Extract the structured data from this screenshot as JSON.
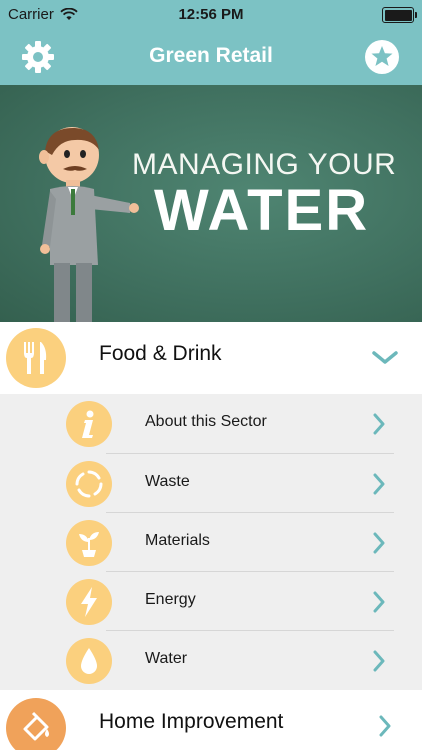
{
  "status_bar": {
    "carrier": "Carrier",
    "time": "12:56 PM"
  },
  "nav": {
    "title": "Green Retail",
    "left_icon": "gear-icon",
    "right_icon": "star-icon"
  },
  "banner": {
    "line1": "MANAGING YOUR",
    "line2": "WATER"
  },
  "sections": [
    {
      "label": "Food & Drink",
      "icon": "fork-knife-icon",
      "icon_color": "#fbd07e",
      "expanded": true,
      "items": [
        {
          "label": "About this Sector",
          "icon": "info-icon"
        },
        {
          "label": "Waste",
          "icon": "recycle-icon"
        },
        {
          "label": "Materials",
          "icon": "plant-icon"
        },
        {
          "label": "Energy",
          "icon": "lightning-icon"
        },
        {
          "label": "Water",
          "icon": "water-drop-icon"
        }
      ]
    },
    {
      "label": "Home Improvement",
      "icon": "paint-bucket-icon",
      "icon_color": "#f0a25a",
      "expanded": false
    }
  ],
  "colors": {
    "accent": "#7cc2c4",
    "chevron": "#6cb8bb",
    "icon_circle": "#fbd07e",
    "banner": "#3f6f5e"
  }
}
